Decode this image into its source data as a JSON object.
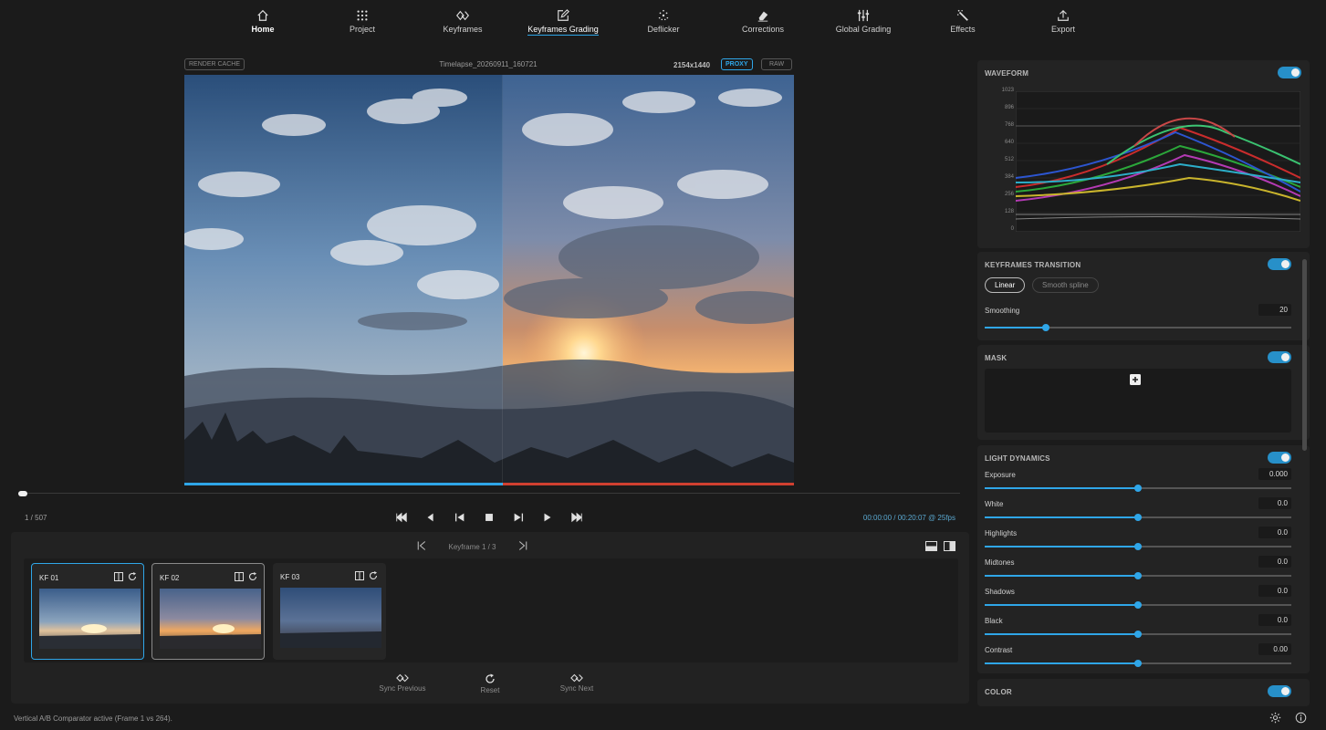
{
  "nav": {
    "items": [
      {
        "label": "Home",
        "icon": "home-icon"
      },
      {
        "label": "Project",
        "icon": "grid-icon"
      },
      {
        "label": "Keyframes",
        "icon": "keyframe-icon"
      },
      {
        "label": "Keyframes Grading",
        "icon": "edit-icon"
      },
      {
        "label": "Deflicker",
        "icon": "sparkle-icon"
      },
      {
        "label": "Corrections",
        "icon": "eraser-icon"
      },
      {
        "label": "Global Grading",
        "icon": "sliders-icon"
      },
      {
        "label": "Effects",
        "icon": "magic-wand-icon"
      },
      {
        "label": "Export",
        "icon": "upload-icon"
      }
    ]
  },
  "viewer": {
    "render_cache": "RENDER CACHE",
    "filename": "Timelapse_20260911_160721",
    "resolution": "2154x1440",
    "proxy": "PROXY",
    "raw": "RAW"
  },
  "playback": {
    "frame_counter": "1 / 507",
    "timecode": "00:00:00 / 00:20:07 @ 25fps",
    "progress": 0.0
  },
  "keyframes": {
    "nav_label": "Keyframe 1 / 3",
    "cards": [
      {
        "label": "KF 01"
      },
      {
        "label": "KF 02"
      },
      {
        "label": "KF 03"
      }
    ],
    "sync_previous": "Sync Previous",
    "reset": "Reset",
    "sync_next": "Sync Next"
  },
  "status": "Vertical A/B Comparator active (Frame 1 vs 264).",
  "waveform": {
    "title": "WAVEFORM",
    "ticks": [
      "1023",
      "896",
      "768",
      "640",
      "512",
      "384",
      "256",
      "128",
      "0"
    ],
    "enabled": true
  },
  "transition": {
    "title": "KEYFRAMES TRANSITION",
    "linear": "Linear",
    "smooth": "Smooth spline",
    "smoothing_label": "Smoothing",
    "smoothing_value": "20",
    "smoothing_fraction": 0.2
  },
  "mask": {
    "title": "MASK"
  },
  "light": {
    "title": "LIGHT DYNAMICS",
    "sliders": [
      {
        "label": "Exposure",
        "value": "0.000",
        "fraction": 0.5
      },
      {
        "label": "White",
        "value": "0.0",
        "fraction": 0.5
      },
      {
        "label": "Highlights",
        "value": "0.0",
        "fraction": 0.5
      },
      {
        "label": "Midtones",
        "value": "0.0",
        "fraction": 0.5
      },
      {
        "label": "Shadows",
        "value": "0.0",
        "fraction": 0.5
      },
      {
        "label": "Black",
        "value": "0.0",
        "fraction": 0.5
      },
      {
        "label": "Contrast",
        "value": "0.00",
        "fraction": 0.5
      }
    ]
  },
  "color": {
    "title": "COLOR"
  },
  "colors": {
    "accent": "#2fa6e8",
    "toggle": "#2790c9",
    "background": "#1b1b1b",
    "panel": "#232323"
  }
}
